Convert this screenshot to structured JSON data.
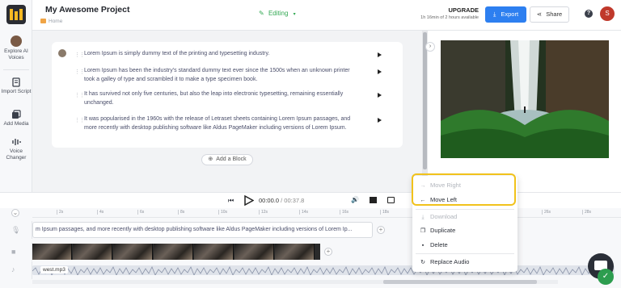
{
  "header": {
    "project_title": "My Awesome Project",
    "breadcrumb": "Home",
    "mode": "Editing",
    "upgrade_title": "UPGRADE",
    "upgrade_sub": "1h 16min of 2 hours available",
    "export_label": "Export",
    "share_label": "Share",
    "help_label": "?",
    "avatar_initial": "S"
  },
  "sidebar": {
    "items": [
      {
        "label": "Explore AI Voices",
        "icon": "ai-voices-avatar-icon"
      },
      {
        "label": "Import Script",
        "icon": "import-script-icon"
      },
      {
        "label": "Add Media",
        "icon": "add-media-icon"
      },
      {
        "label": "Voice Changer",
        "icon": "voice-changer-icon"
      }
    ]
  },
  "script": {
    "paragraphs": [
      "Lorem Ipsum is simply dummy text of the printing and typesetting industry.",
      "Lorem Ipsum has been the industry's standard dummy text ever since the 1500s when an unknown printer took a galley of type and scrambled it to make a type specimen book.",
      "It has survived not only five centuries, but also the leap into electronic typesetting, remaining essentially unchanged.",
      "It was popularised in the 1960s with the release of Letraset sheets containing Lorem Ipsum passages, and more recently with desktop publishing software like Aldus PageMaker including versions of Lorem Ipsum."
    ],
    "add_block_label": "Add a Block"
  },
  "player": {
    "current_time": "00:00.0",
    "separator": " / ",
    "total_time": "00:37.8"
  },
  "timeline": {
    "ruler_ticks": [
      "2s",
      "4s",
      "6s",
      "8s",
      "10s",
      "12s",
      "14s",
      "16s",
      "18s",
      "20s",
      "22s",
      "24s",
      "26s",
      "28s"
    ],
    "text_clip": "m Ipsum passages, and more recently with desktop publishing software like Aldus PageMaker including versions of Lorem Ip...",
    "audio_clip_name": "west.mp3"
  },
  "context_menu": {
    "items": [
      {
        "label": "Move Right",
        "icon": "arrow-right-icon",
        "disabled": true
      },
      {
        "label": "Move Left",
        "icon": "arrow-left-icon",
        "disabled": false
      },
      {
        "label": "Download",
        "icon": "download-icon",
        "disabled": true
      },
      {
        "label": "Duplicate",
        "icon": "duplicate-icon",
        "disabled": false
      },
      {
        "label": "Delete",
        "icon": "trash-icon",
        "disabled": false
      },
      {
        "label": "Replace Audio",
        "icon": "replace-audio-icon",
        "disabled": false
      }
    ]
  },
  "colors": {
    "accent": "#2d7ff0",
    "editing_green": "#33a853",
    "highlight": "#f1c21b"
  }
}
